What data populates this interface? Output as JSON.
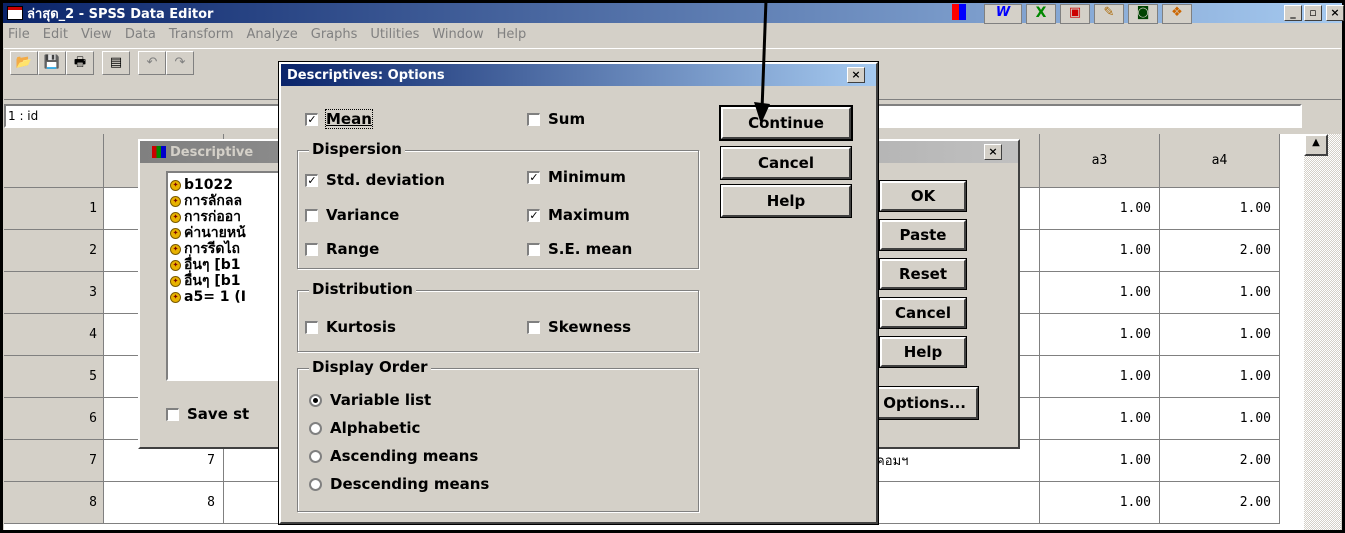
{
  "window": {
    "title": "ล่าสุด_2 - SPSS Data Editor",
    "minimize": "_",
    "maximize": "▫",
    "close": "×"
  },
  "menu": [
    "File",
    "Edit",
    "View",
    "Data",
    "Transform",
    "Analyze",
    "Graphs",
    "Utilities",
    "Window",
    "Help"
  ],
  "cell_ref": "1 : id",
  "grid": {
    "columns": [
      "a3",
      "a4"
    ],
    "rows": [
      "1",
      "2",
      "3",
      "4",
      "5",
      "6",
      "7",
      "8"
    ],
    "col2_row7": "7",
    "col2_row8": "8",
    "partial_text_row7": "อบคอมฯ",
    "a3": [
      "1.00",
      "1.00",
      "1.00",
      "1.00",
      "1.00",
      "1.00",
      "1.00",
      "1.00"
    ],
    "a4": [
      "1.00",
      "2.00",
      "1.00",
      "1.00",
      "1.00",
      "1.00",
      "2.00",
      "2.00"
    ]
  },
  "descriptives_dialog": {
    "title": "Descriptive",
    "variables": [
      "b1022",
      "การลักลล",
      "การก่ออา",
      "ค่านายหน้",
      "การรีดไถ",
      "อื่นๆ [b1",
      "อื่นๆ [b1",
      "a5= 1 (I"
    ],
    "save_label": "Save st",
    "buttons": {
      "ok": "OK",
      "paste": "Paste",
      "reset": "Reset",
      "cancel": "Cancel",
      "help": "Help",
      "options": "Options..."
    },
    "close": "×"
  },
  "options_dialog": {
    "title": "Descriptives: Options",
    "close": "×",
    "mean": {
      "label": "Mean",
      "checked": true
    },
    "sum": {
      "label": "Sum",
      "checked": false
    },
    "dispersion": {
      "label": "Dispersion",
      "std_deviation": {
        "label": "Std. deviation",
        "checked": true
      },
      "minimum": {
        "label": "Minimum",
        "checked": true
      },
      "variance": {
        "label": "Variance",
        "checked": false
      },
      "maximum": {
        "label": "Maximum",
        "checked": true
      },
      "range": {
        "label": "Range",
        "checked": false
      },
      "se_mean": {
        "label": "S.E. mean",
        "checked": false
      }
    },
    "distribution": {
      "label": "Distribution",
      "kurtosis": {
        "label": "Kurtosis",
        "checked": false
      },
      "skewness": {
        "label": "Skewness",
        "checked": false
      }
    },
    "display_order": {
      "label": "Display Order",
      "options": [
        "Variable list",
        "Alphabetic",
        "Ascending means",
        "Descending means"
      ],
      "selected": "Variable list"
    },
    "buttons": {
      "continue": "Continue",
      "cancel": "Cancel",
      "help": "Help"
    }
  }
}
